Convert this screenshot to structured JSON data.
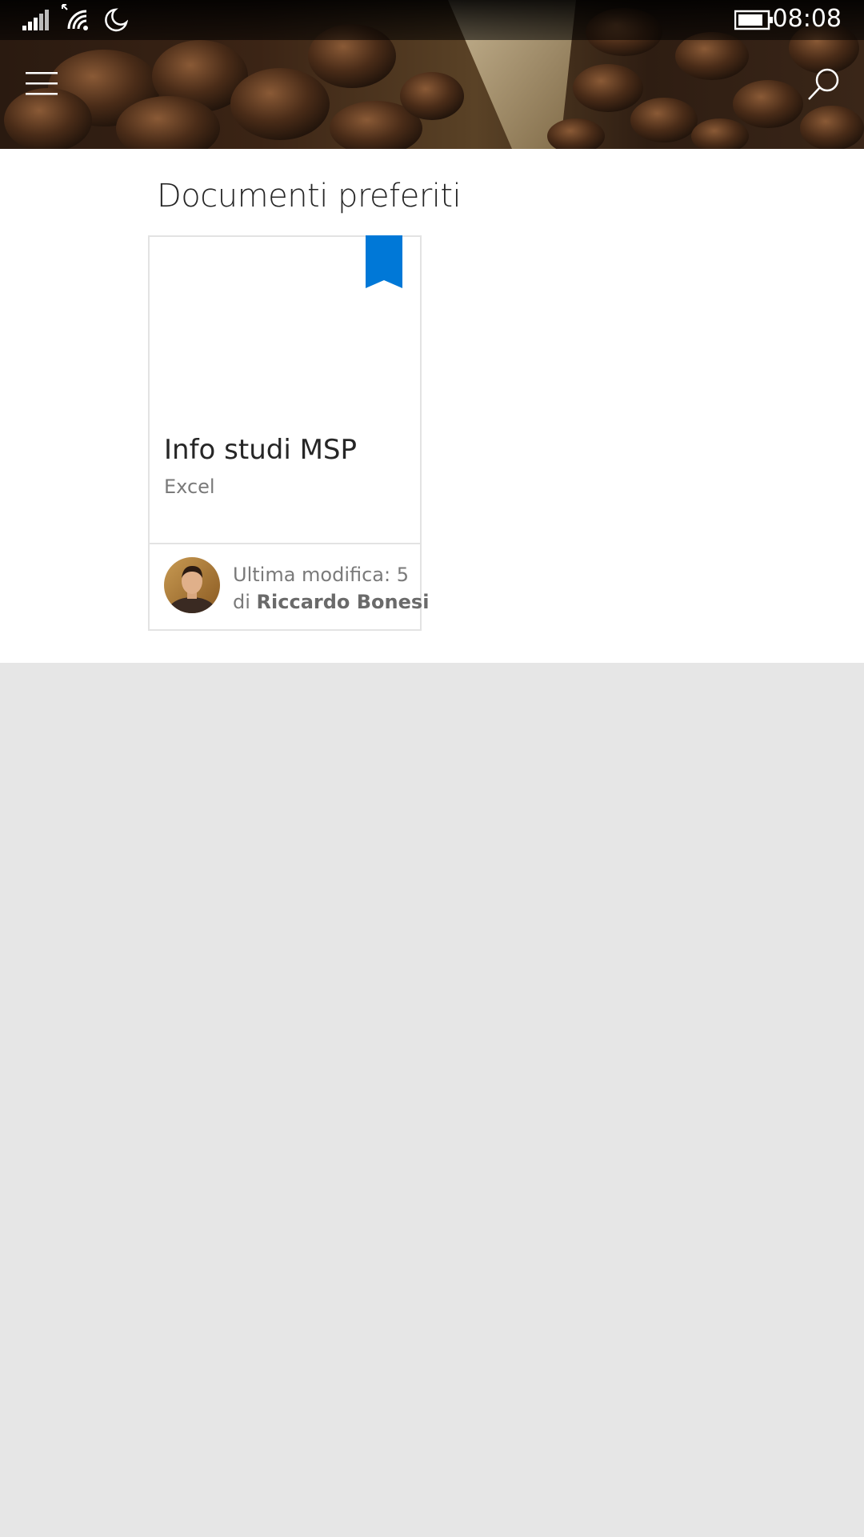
{
  "status_bar": {
    "time": "08:08",
    "icons": [
      "signal-icon",
      "wifi-icon",
      "quiet-hours-moon-icon",
      "battery-icon"
    ]
  },
  "header": {
    "menu_icon": "hamburger-menu-icon",
    "search_icon": "search-icon"
  },
  "main": {
    "section_title": "Documenti preferiti",
    "documents": [
      {
        "title": "Info studi MSP",
        "type": "Excel",
        "modified_label": "Ultima modifica: 5...",
        "author_prefix": "di",
        "author_name": "Riccardo Bonesi",
        "bookmark_color": "#0078d7"
      }
    ]
  },
  "colors": {
    "accent": "#0078d7",
    "page_background": "#e6e6e6",
    "card_border": "#e3e3e3"
  }
}
